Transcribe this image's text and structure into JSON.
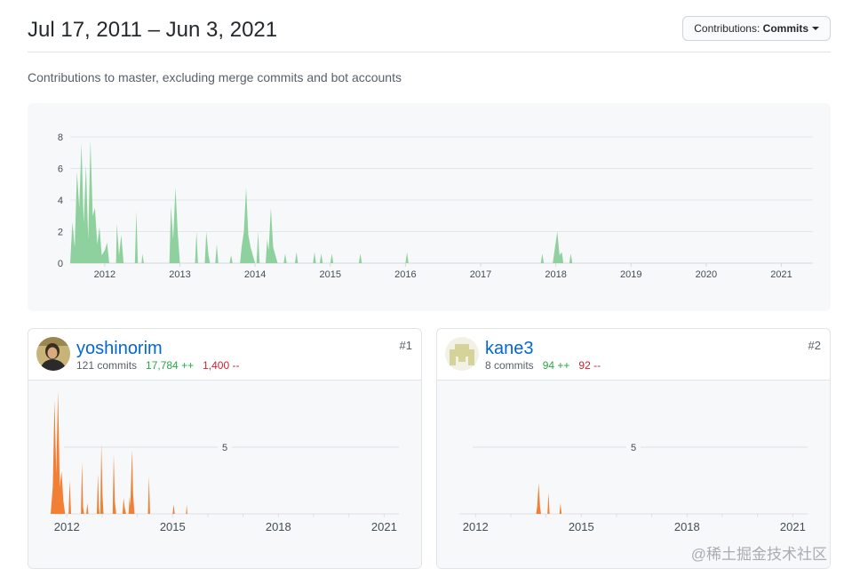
{
  "header": {
    "date_range": "Jul 17, 2011 – Jun 3, 2021",
    "contrib_label": "Contributions:",
    "contrib_value": "Commits"
  },
  "subtitle": "Contributions to master, excluding merge commits and bot accounts",
  "colors": {
    "main_fill": "#8fd19e",
    "user_fill": "#f17f34",
    "link": "#0366d6",
    "add": "#28a745",
    "del": "#cb2431"
  },
  "chart_data": [
    {
      "type": "area",
      "ylim": [
        0,
        8
      ],
      "yticks": [
        "0",
        "2",
        "4",
        "6",
        "8"
      ],
      "xlim": [
        2011.54,
        2021.42
      ],
      "xticks": [
        "2012",
        "2013",
        "2014",
        "2015",
        "2016",
        "2017",
        "2018",
        "2019",
        "2020",
        "2021"
      ],
      "points": [
        [
          2011.54,
          0
        ],
        [
          2011.57,
          2.6
        ],
        [
          2011.6,
          1
        ],
        [
          2011.63,
          5.8
        ],
        [
          2011.66,
          3.5
        ],
        [
          2011.69,
          7.6
        ],
        [
          2011.72,
          2.5
        ],
        [
          2011.75,
          6.2
        ],
        [
          2011.78,
          1.5
        ],
        [
          2011.81,
          7.8
        ],
        [
          2011.84,
          3
        ],
        [
          2011.87,
          3.5
        ],
        [
          2011.9,
          1.2
        ],
        [
          2011.93,
          2.3
        ],
        [
          2011.96,
          0.5
        ],
        [
          2012.0,
          0.8
        ],
        [
          2012.03,
          1.3
        ],
        [
          2012.06,
          0
        ],
        [
          2012.15,
          0
        ],
        [
          2012.16,
          2.5
        ],
        [
          2012.19,
          0.5
        ],
        [
          2012.22,
          1.8
        ],
        [
          2012.25,
          0
        ],
        [
          2012.4,
          0
        ],
        [
          2012.42,
          3.3
        ],
        [
          2012.44,
          0
        ],
        [
          2012.49,
          0
        ],
        [
          2012.5,
          0.6
        ],
        [
          2012.52,
          0
        ],
        [
          2012.86,
          0
        ],
        [
          2012.88,
          3.6
        ],
        [
          2012.91,
          1.5
        ],
        [
          2012.94,
          4.8
        ],
        [
          2012.97,
          2
        ],
        [
          2013.0,
          0
        ],
        [
          2013.2,
          0
        ],
        [
          2013.22,
          2
        ],
        [
          2013.24,
          0
        ],
        [
          2013.33,
          0
        ],
        [
          2013.35,
          2
        ],
        [
          2013.38,
          0.5
        ],
        [
          2013.4,
          0
        ],
        [
          2013.47,
          0
        ],
        [
          2013.49,
          1.2
        ],
        [
          2013.51,
          0
        ],
        [
          2013.66,
          0
        ],
        [
          2013.68,
          0.5
        ],
        [
          2013.7,
          0
        ],
        [
          2013.8,
          0
        ],
        [
          2013.82,
          1
        ],
        [
          2013.85,
          2
        ],
        [
          2013.88,
          4.8
        ],
        [
          2013.91,
          1.8
        ],
        [
          2013.94,
          1
        ],
        [
          2013.97,
          0.5
        ],
        [
          2014.0,
          0
        ],
        [
          2014.02,
          0
        ],
        [
          2014.04,
          2
        ],
        [
          2014.06,
          0
        ],
        [
          2014.14,
          0
        ],
        [
          2014.16,
          1.5
        ],
        [
          2014.18,
          0.8
        ],
        [
          2014.21,
          3.5
        ],
        [
          2014.24,
          1
        ],
        [
          2014.27,
          0.5
        ],
        [
          2014.3,
          0
        ],
        [
          2014.38,
          0
        ],
        [
          2014.4,
          0.6
        ],
        [
          2014.42,
          0
        ],
        [
          2014.53,
          0
        ],
        [
          2014.55,
          0.7
        ],
        [
          2014.57,
          0
        ],
        [
          2014.77,
          0
        ],
        [
          2014.79,
          0.7
        ],
        [
          2014.81,
          0
        ],
        [
          2014.86,
          0
        ],
        [
          2014.88,
          0.6
        ],
        [
          2014.9,
          0
        ],
        [
          2015.0,
          0
        ],
        [
          2015.02,
          0.6
        ],
        [
          2015.04,
          0
        ],
        [
          2015.38,
          0
        ],
        [
          2015.4,
          0.6
        ],
        [
          2015.42,
          0
        ],
        [
          2016.0,
          0
        ],
        [
          2016.02,
          0.7
        ],
        [
          2016.04,
          0
        ],
        [
          2017.8,
          0
        ],
        [
          2017.82,
          0.6
        ],
        [
          2017.84,
          0
        ],
        [
          2017.96,
          0
        ],
        [
          2017.98,
          0.7
        ],
        [
          2018.02,
          2
        ],
        [
          2018.05,
          0.5
        ],
        [
          2018.08,
          0.7
        ],
        [
          2018.1,
          0
        ],
        [
          2018.18,
          0
        ],
        [
          2018.2,
          0.6
        ],
        [
          2018.22,
          0
        ],
        [
          2021.42,
          0
        ]
      ]
    },
    {
      "type": "area",
      "ylim": [
        0,
        10
      ],
      "midline_label": "5",
      "xlim": [
        2011.54,
        2021.42
      ],
      "xticks": [
        "2012",
        "2015",
        "2018",
        "2021"
      ],
      "points": [
        [
          2011.54,
          0
        ],
        [
          2011.6,
          2
        ],
        [
          2011.65,
          8.5
        ],
        [
          2011.7,
          3
        ],
        [
          2011.75,
          9.2
        ],
        [
          2011.8,
          2
        ],
        [
          2011.85,
          3.2
        ],
        [
          2011.9,
          1
        ],
        [
          2011.95,
          0
        ],
        [
          2012.05,
          0
        ],
        [
          2012.08,
          2.5
        ],
        [
          2012.12,
          0
        ],
        [
          2012.4,
          0
        ],
        [
          2012.43,
          3.9
        ],
        [
          2012.46,
          0.5
        ],
        [
          2012.49,
          0
        ],
        [
          2012.55,
          0
        ],
        [
          2012.58,
          0.8
        ],
        [
          2012.61,
          0
        ],
        [
          2012.85,
          0
        ],
        [
          2012.88,
          3
        ],
        [
          2012.91,
          0.5
        ],
        [
          2012.93,
          0
        ],
        [
          2012.95,
          0
        ],
        [
          2012.98,
          5.3
        ],
        [
          2013.01,
          1.5
        ],
        [
          2013.04,
          0
        ],
        [
          2013.3,
          0
        ],
        [
          2013.33,
          4.5
        ],
        [
          2013.36,
          1
        ],
        [
          2013.4,
          0
        ],
        [
          2013.58,
          0
        ],
        [
          2013.61,
          1.2
        ],
        [
          2013.64,
          0.5
        ],
        [
          2013.68,
          0
        ],
        [
          2013.75,
          0
        ],
        [
          2013.78,
          1.3
        ],
        [
          2013.8,
          0.6
        ],
        [
          2013.85,
          4.8
        ],
        [
          2013.88,
          1.5
        ],
        [
          2013.92,
          0
        ],
        [
          2014.3,
          0
        ],
        [
          2014.33,
          2.8
        ],
        [
          2014.36,
          0
        ],
        [
          2015.0,
          0
        ],
        [
          2015.03,
          0.7
        ],
        [
          2015.06,
          0
        ],
        [
          2015.38,
          0
        ],
        [
          2015.4,
          0.7
        ],
        [
          2015.42,
          0
        ],
        [
          2021.42,
          0
        ]
      ]
    },
    {
      "type": "area",
      "ylim": [
        0,
        10
      ],
      "midline_label": "5",
      "xlim": [
        2011.54,
        2021.42
      ],
      "xticks": [
        "2012",
        "2015",
        "2018",
        "2021"
      ],
      "points": [
        [
          2011.54,
          0
        ],
        [
          2013.72,
          0
        ],
        [
          2013.75,
          0.6
        ],
        [
          2013.79,
          2.3
        ],
        [
          2013.83,
          0.5
        ],
        [
          2013.86,
          0
        ],
        [
          2014.04,
          0
        ],
        [
          2014.07,
          1.6
        ],
        [
          2014.1,
          0
        ],
        [
          2014.38,
          0
        ],
        [
          2014.41,
          0.8
        ],
        [
          2014.44,
          0
        ],
        [
          2021.42,
          0
        ]
      ]
    }
  ],
  "contributors": [
    {
      "username": "yoshinorim",
      "rank": "#1",
      "commits": "121 commits",
      "additions": "17,784 ++",
      "deletions": "1,400 --"
    },
    {
      "username": "kane3",
      "rank": "#2",
      "commits": "8 commits",
      "additions": "94 ++",
      "deletions": "92 --"
    }
  ],
  "watermark": "@稀土掘金技术社区"
}
